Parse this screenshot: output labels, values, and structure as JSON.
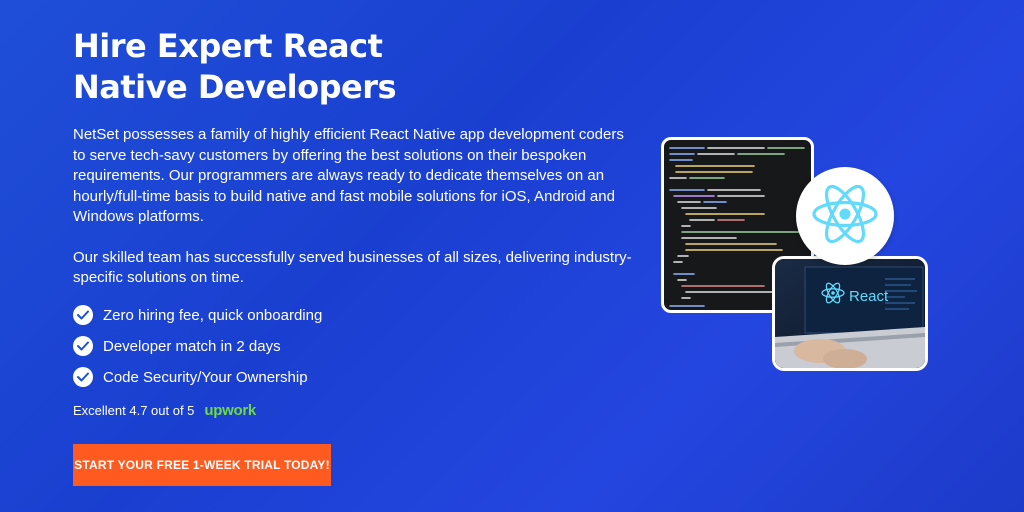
{
  "hero": {
    "title": "Hire Expert React Native Developers",
    "paragraph1": "NetSet possesses a family of highly efficient React Native app development coders to serve tech-savy customers by offering the best solutions on their bespoken requirements. Our programmers are always ready to dedicate themselves on an hourly/full-time basis to build native and fast mobile solutions for iOS, Android and Windows platforms.",
    "paragraph2": "Our skilled team has successfully served businesses of all sizes, delivering industry-specific solutions on time.",
    "features": [
      {
        "label": "Zero hiring fee, quick onboarding",
        "icon": "check-circle-icon"
      },
      {
        "label": "Developer match in 2 days",
        "icon": "check-circle-icon"
      },
      {
        "label": "Code Security/Your Ownership",
        "icon": "check-circle-icon"
      }
    ],
    "rating_text": "Excellent 4.7 out of 5",
    "rating_brand": "Upwork",
    "cta_label": "START YOUR FREE 1-WEEK TRIAL TODAY!"
  },
  "illustration": {
    "laptop_brand": "React"
  },
  "colors": {
    "background": "#1f4fd8",
    "cta": "#ff5a1f",
    "upwork": "#6fda44",
    "react": "#61dafb"
  }
}
